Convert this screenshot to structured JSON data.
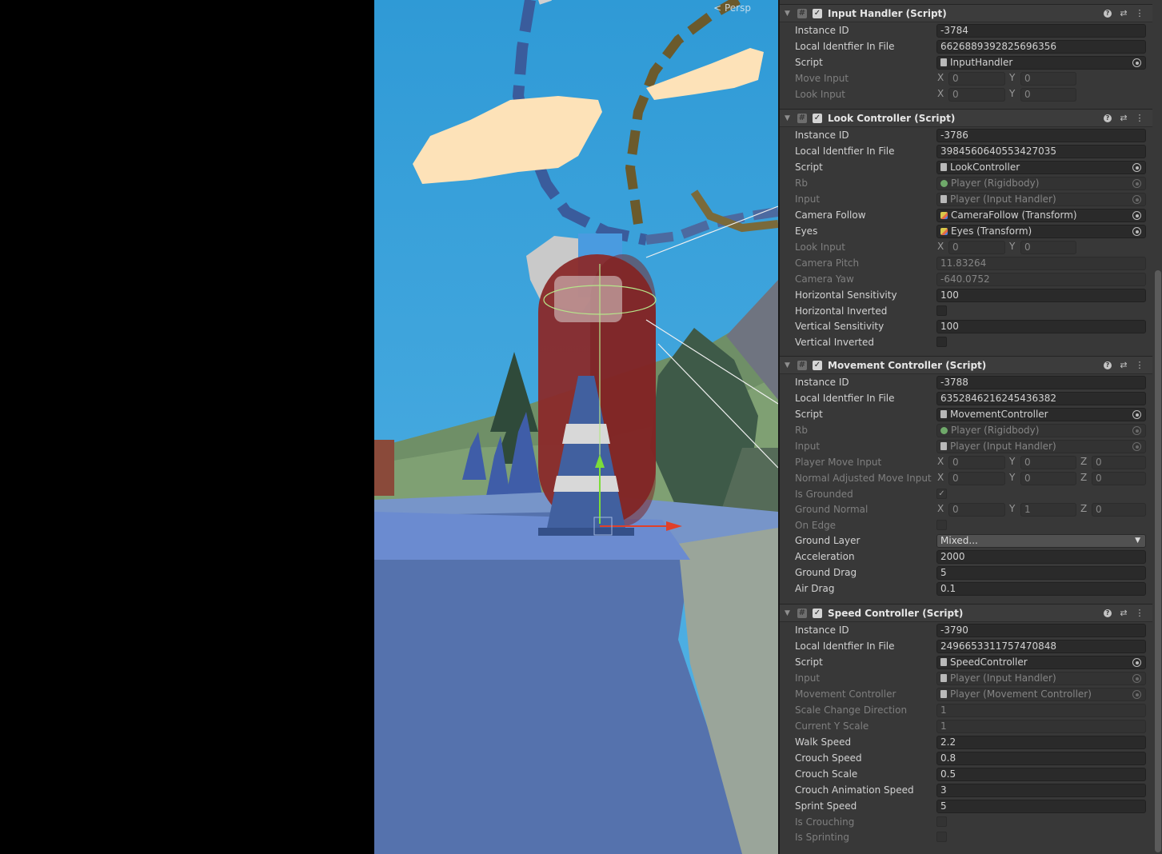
{
  "scene": {
    "persp_label": "< Persp"
  },
  "components": [
    {
      "title": "Input Handler (Script)",
      "rows": [
        {
          "label": "Instance ID",
          "type": "text",
          "value": "-3784"
        },
        {
          "label": "Local Identfier In File",
          "type": "text",
          "value": "6626889392825696356"
        },
        {
          "label": "Script",
          "type": "object",
          "value": "InputHandler",
          "icon": "script-icon"
        },
        {
          "label": "Move Input",
          "type": "vec2",
          "disabled": true,
          "x": "0",
          "y": "0"
        },
        {
          "label": "Look Input",
          "type": "vec2",
          "disabled": true,
          "x": "0",
          "y": "0"
        }
      ]
    },
    {
      "title": "Look Controller (Script)",
      "rows": [
        {
          "label": "Instance ID",
          "type": "text",
          "value": "-3786"
        },
        {
          "label": "Local Identfier In File",
          "type": "text",
          "value": "3984560640553427035"
        },
        {
          "label": "Script",
          "type": "object",
          "value": "LookController",
          "icon": "script-icon"
        },
        {
          "label": "Rb",
          "type": "object",
          "disabled": true,
          "value": "Player (Rigidbody)",
          "icon": "rigidbody-icon"
        },
        {
          "label": "Input",
          "type": "object",
          "disabled": true,
          "value": "Player (Input Handler)",
          "icon": "script-icon"
        },
        {
          "label": "Camera Follow",
          "type": "object",
          "value": "CameraFollow (Transform)",
          "icon": "transform-icon"
        },
        {
          "label": "Eyes",
          "type": "object",
          "value": "Eyes (Transform)",
          "icon": "transform-icon"
        },
        {
          "label": "Look Input",
          "type": "vec2",
          "disabled": true,
          "x": "0",
          "y": "0"
        },
        {
          "label": "Camera Pitch",
          "type": "text",
          "disabled": true,
          "value": "11.83264"
        },
        {
          "label": "Camera Yaw",
          "type": "text",
          "disabled": true,
          "value": "-640.0752"
        },
        {
          "label": "Horizontal Sensitivity",
          "type": "text",
          "value": "100"
        },
        {
          "label": "Horizontal Inverted",
          "type": "check",
          "checked": false
        },
        {
          "label": "Vertical Sensitivity",
          "type": "text",
          "value": "100"
        },
        {
          "label": "Vertical Inverted",
          "type": "check",
          "checked": false
        }
      ]
    },
    {
      "title": "Movement Controller (Script)",
      "rows": [
        {
          "label": "Instance ID",
          "type": "text",
          "value": "-3788"
        },
        {
          "label": "Local Identfier In File",
          "type": "text",
          "value": "6352846216245436382"
        },
        {
          "label": "Script",
          "type": "object",
          "value": "MovementController",
          "icon": "script-icon"
        },
        {
          "label": "Rb",
          "type": "object",
          "disabled": true,
          "value": "Player (Rigidbody)",
          "icon": "rigidbody-icon"
        },
        {
          "label": "Input",
          "type": "object",
          "disabled": true,
          "value": "Player (Input Handler)",
          "icon": "script-icon"
        },
        {
          "label": "Player Move Input",
          "type": "vec3",
          "disabled": true,
          "x": "0",
          "y": "0",
          "z": "0"
        },
        {
          "label": "Normal Adjusted Move Input",
          "type": "vec3",
          "disabled": true,
          "x": "0",
          "y": "0",
          "z": "0"
        },
        {
          "label": "Is Grounded",
          "type": "check",
          "disabled": true,
          "checked": true
        },
        {
          "label": "Ground Normal",
          "type": "vec3",
          "disabled": true,
          "x": "0",
          "y": "1",
          "z": "0"
        },
        {
          "label": "On Edge",
          "type": "check",
          "disabled": true,
          "checked": false
        },
        {
          "label": "Ground Layer",
          "type": "dropdown",
          "value": "Mixed..."
        },
        {
          "label": "Acceleration",
          "type": "text",
          "value": "2000"
        },
        {
          "label": "Ground Drag",
          "type": "text",
          "value": "5"
        },
        {
          "label": "Air Drag",
          "type": "text",
          "value": "0.1"
        }
      ]
    },
    {
      "title": "Speed Controller (Script)",
      "rows": [
        {
          "label": "Instance ID",
          "type": "text",
          "value": "-3790"
        },
        {
          "label": "Local Identfier In File",
          "type": "text",
          "value": "2496653311757470848"
        },
        {
          "label": "Script",
          "type": "object",
          "value": "SpeedController",
          "icon": "script-icon"
        },
        {
          "label": "Input",
          "type": "object",
          "disabled": true,
          "value": "Player (Input Handler)",
          "icon": "script-icon"
        },
        {
          "label": "Movement Controller",
          "type": "object",
          "disabled": true,
          "value": "Player (Movement Controller)",
          "icon": "script-icon"
        },
        {
          "label": "Scale Change Direction",
          "type": "text",
          "disabled": true,
          "value": "1"
        },
        {
          "label": "Current Y Scale",
          "type": "text",
          "disabled": true,
          "value": "1"
        },
        {
          "label": "Walk Speed",
          "type": "text",
          "value": "2.2"
        },
        {
          "label": "Crouch Speed",
          "type": "text",
          "value": "0.8"
        },
        {
          "label": "Crouch Scale",
          "type": "text",
          "value": "0.5"
        },
        {
          "label": "Crouch Animation Speed",
          "type": "text",
          "value": "3"
        },
        {
          "label": "Sprint Speed",
          "type": "text",
          "value": "5"
        },
        {
          "label": "Is Crouching",
          "type": "check",
          "disabled": true,
          "checked": false
        },
        {
          "label": "Is Sprinting",
          "type": "check",
          "disabled": true,
          "checked": false
        }
      ]
    }
  ]
}
